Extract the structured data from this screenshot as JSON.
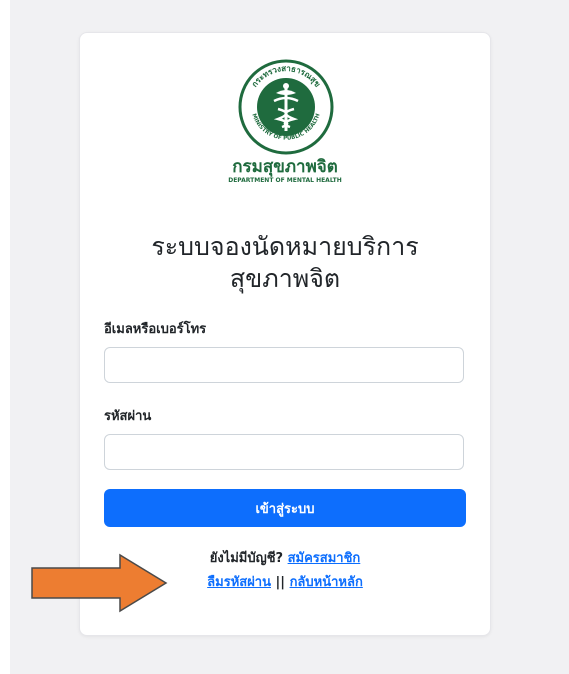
{
  "logo": {
    "title": "กรมสุขภาพจิต",
    "subtitle": "DEPARTMENT OF MENTAL HEALTH",
    "ring_top_text": "กระทรวงสาธารณสุข",
    "ring_bottom_text": "MINISTRY OF PUBLIC HEALTH",
    "green": "#1f6b3e"
  },
  "form": {
    "title_line1": "ระบบจองนัดหมายบริการ",
    "title_line2": "สุขภาพจิต",
    "email_label": "อีเมลหรือเบอร์โทร",
    "email_value": "",
    "password_label": "รหัสผ่าน",
    "password_value": "",
    "submit_label": "เข้าสู่ระบบ"
  },
  "links": {
    "no_account_text": "ยังไม่มีบัญชี?",
    "register_link": "สมัครสมาชิก",
    "forgot_link": "ลืมรหัสผ่าน",
    "separator": "||",
    "home_link": "กลับหน้าหลัก"
  },
  "annotation": {
    "arrow_color": "#ed7d31",
    "arrow_icon": "arrow-right-icon"
  },
  "colors": {
    "primary": "#0d6efd",
    "page_bg": "#f1f1f3"
  }
}
